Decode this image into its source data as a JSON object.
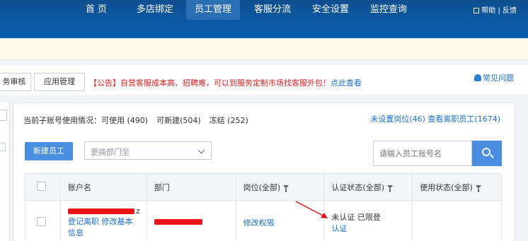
{
  "nav": {
    "items": [
      "首 页",
      "多店绑定",
      "员工管理",
      "客服分流",
      "安全设置",
      "监控查询"
    ],
    "help_label": "帮助",
    "feedback_label": "反馈"
  },
  "subbar": {
    "tab_1": "务审核",
    "tab_2": "应用管理",
    "announce_prefix": "【公告】自营客服成本高、招聘难，可以到服务定制市场找客服外包！",
    "announce_link": "点此查看",
    "faq": "常见问题"
  },
  "panel": {
    "usage_label": "当前子账号使用情况：",
    "usable": "可使用 (490)",
    "creatable": "可新建(504)",
    "frozen": "冻结 (252)",
    "unset_post": "未设置岗位(46)",
    "view_resigned": "查看离职员工(1674)",
    "new_employee_btn": "新建员工",
    "dept_placeholder": "更换部门至",
    "search_placeholder": "请输入员工账号名"
  },
  "table": {
    "headers": [
      "账户名",
      "部门",
      "岗位(全部)",
      "认证状态(全部)",
      "使用状态(全部)"
    ],
    "row": {
      "account_suffix": "z",
      "account_links": "登记离职 修改基本",
      "account_links_2": "信息",
      "post_action": "修改权限",
      "auth_status": "未认证 已限登",
      "auth_link": "认证"
    }
  },
  "colors": {
    "nav_bg": "#0c5aa4",
    "accent": "#4a8ee2",
    "link": "#1a6fd0",
    "alert_red": "#e02020"
  }
}
